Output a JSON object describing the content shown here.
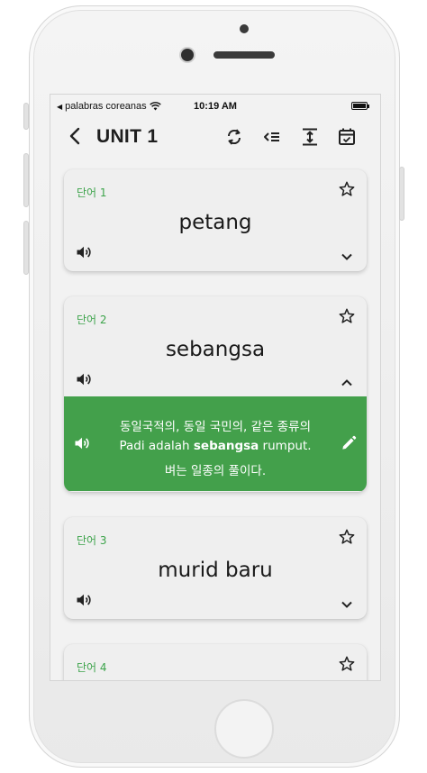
{
  "status_bar": {
    "carrier": "palabras coreanas",
    "time": "10:19 AM"
  },
  "header": {
    "title": "UNIT 1",
    "icons": [
      "back-arrow-icon",
      "repeat-icon",
      "list-check-icon",
      "expand-vertical-icon",
      "calendar-check-icon"
    ]
  },
  "cards": [
    {
      "label": "단어 1",
      "word": "petang",
      "expanded": false
    },
    {
      "label": "단어 2",
      "word": "sebangsa",
      "expanded": true,
      "detail": {
        "meaning": "동일국적의, 동일 국민의, 같은 종류의",
        "example_before": "Padi adalah ",
        "example_bold": "sebangsa",
        "example_after": " rumput.",
        "translation": "벼는 일종의 풀이다."
      }
    },
    {
      "label": "단어 3",
      "word": "murid baru",
      "expanded": false
    },
    {
      "label": "단어 4",
      "word": "",
      "expanded": false
    }
  ],
  "colors": {
    "accent_green": "#43a04b",
    "label_green": "#3ca34a",
    "card_bg": "#efefef",
    "screen_bg": "#f2f2f2"
  }
}
